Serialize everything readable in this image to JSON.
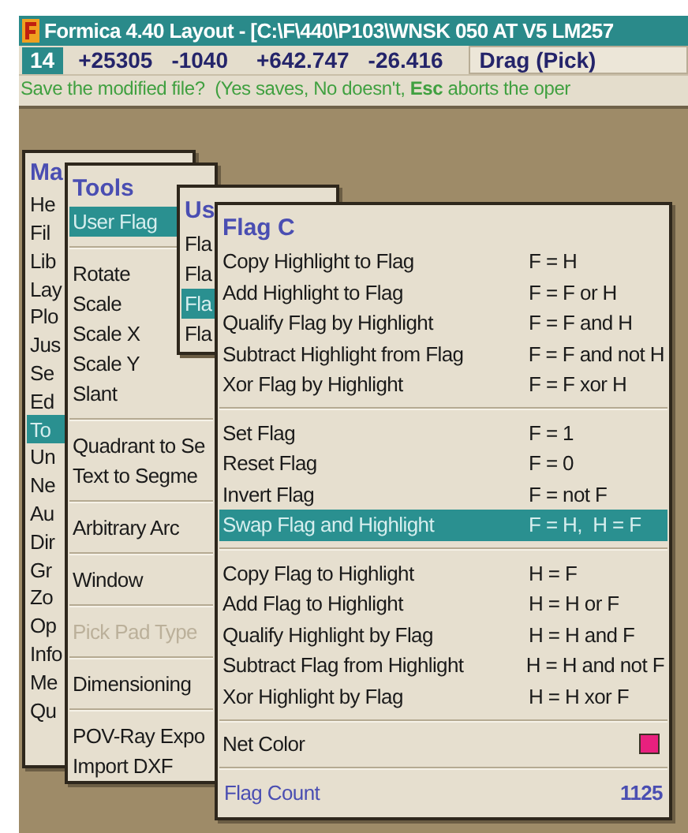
{
  "window": {
    "title": "Formica 4.40 Layout - [C:\\F\\440\\P103\\WNSK 050 AT V5 LM257"
  },
  "toolbar": {
    "layer": "14",
    "values": [
      "+25305",
      "-1040",
      "+642.747",
      "-26.416"
    ],
    "mode": "Drag (Pick)"
  },
  "message": "Save the modified file?  (Yes saves, No doesn't, **Esc** aborts the oper",
  "menus": [
    {
      "title": "Ma",
      "items": [
        {
          "kind": "item",
          "label": "He",
          "selected": false,
          "disabled": false
        },
        {
          "kind": "item",
          "label": "Fil",
          "selected": false,
          "disabled": false
        },
        {
          "kind": "item",
          "label": "Lib",
          "selected": false,
          "disabled": false
        },
        {
          "kind": "item",
          "label": "Lay",
          "selected": false,
          "disabled": false
        },
        {
          "kind": "item",
          "label": "Plo",
          "selected": false,
          "disabled": false
        },
        {
          "kind": "item",
          "label": "Jus",
          "selected": false,
          "disabled": false
        },
        {
          "kind": "item",
          "label": "Se",
          "selected": false,
          "disabled": false
        },
        {
          "kind": "item",
          "label": "Ed",
          "selected": false,
          "disabled": false
        },
        {
          "kind": "item",
          "label": "To",
          "selected": true,
          "disabled": false
        },
        {
          "kind": "item",
          "label": "Un",
          "selected": false,
          "disabled": false
        },
        {
          "kind": "item",
          "label": "Ne",
          "selected": false,
          "disabled": false
        },
        {
          "kind": "item",
          "label": "Au",
          "selected": false,
          "disabled": false
        },
        {
          "kind": "item",
          "label": "Dir",
          "selected": false,
          "disabled": false
        },
        {
          "kind": "item",
          "label": "Gr",
          "selected": false,
          "disabled": false
        },
        {
          "kind": "item",
          "label": "Zo",
          "selected": false,
          "disabled": false
        },
        {
          "kind": "item",
          "label": "Op",
          "selected": false,
          "disabled": false
        },
        {
          "kind": "item",
          "label": "Info",
          "selected": false,
          "disabled": false
        },
        {
          "kind": "item",
          "label": "Me",
          "selected": false,
          "disabled": false
        },
        {
          "kind": "item",
          "label": "Qu",
          "selected": false,
          "disabled": false
        }
      ]
    },
    {
      "title": "Tools",
      "items": [
        {
          "kind": "item",
          "label": "User Flag",
          "selected": true,
          "disabled": false
        },
        {
          "kind": "separator"
        },
        {
          "kind": "item",
          "label": "Rotate",
          "selected": false,
          "disabled": false
        },
        {
          "kind": "item",
          "label": "Scale",
          "selected": false,
          "disabled": false
        },
        {
          "kind": "item",
          "label": "Scale X",
          "selected": false,
          "disabled": false
        },
        {
          "kind": "item",
          "label": "Scale Y",
          "selected": false,
          "disabled": false
        },
        {
          "kind": "item",
          "label": "Slant",
          "selected": false,
          "disabled": false
        },
        {
          "kind": "separator"
        },
        {
          "kind": "item",
          "label": "Quadrant to Se",
          "selected": false,
          "disabled": false
        },
        {
          "kind": "item",
          "label": "Text to Segme",
          "selected": false,
          "disabled": false
        },
        {
          "kind": "separator"
        },
        {
          "kind": "item",
          "label": "Arbitrary Arc",
          "selected": false,
          "disabled": false
        },
        {
          "kind": "separator"
        },
        {
          "kind": "item",
          "label": "Window",
          "selected": false,
          "disabled": false
        },
        {
          "kind": "separator"
        },
        {
          "kind": "item",
          "label": "Pick Pad Type",
          "selected": false,
          "disabled": true
        },
        {
          "kind": "separator"
        },
        {
          "kind": "item",
          "label": "Dimensioning",
          "selected": false,
          "disabled": false
        },
        {
          "kind": "separator"
        },
        {
          "kind": "item",
          "label": "POV-Ray Expo",
          "selected": false,
          "disabled": false
        },
        {
          "kind": "item",
          "label": "Import DXF",
          "selected": false,
          "disabled": false
        }
      ]
    },
    {
      "title": "Us",
      "items": [
        {
          "kind": "item",
          "label": "Fla",
          "selected": false,
          "disabled": false
        },
        {
          "kind": "item",
          "label": "Fla",
          "selected": false,
          "disabled": false
        },
        {
          "kind": "item",
          "label": "Fla",
          "selected": true,
          "disabled": false
        },
        {
          "kind": "item",
          "label": "Fla",
          "selected": false,
          "disabled": false
        }
      ]
    },
    {
      "title": "Flag C",
      "items": [
        {
          "kind": "item",
          "label": "Copy Highlight to Flag",
          "shortcut": "F = H",
          "selected": false,
          "disabled": false
        },
        {
          "kind": "item",
          "label": "Add Highlight to Flag",
          "shortcut": "F = F or H",
          "selected": false,
          "disabled": false
        },
        {
          "kind": "item",
          "label": "Qualify Flag by Highlight",
          "shortcut": "F = F and H",
          "selected": false,
          "disabled": false
        },
        {
          "kind": "item",
          "label": "Subtract Highlight from Flag",
          "shortcut": "F = F and not H",
          "selected": false,
          "disabled": false
        },
        {
          "kind": "item",
          "label": "Xor Flag by Highlight",
          "shortcut": "F = F xor H",
          "selected": false,
          "disabled": false
        },
        {
          "kind": "separator"
        },
        {
          "kind": "item",
          "label": "Set Flag",
          "shortcut": "F = 1",
          "selected": false,
          "disabled": false
        },
        {
          "kind": "item",
          "label": "Reset Flag",
          "shortcut": "F = 0",
          "selected": false,
          "disabled": false
        },
        {
          "kind": "item",
          "label": "Invert Flag",
          "shortcut": "F = not F",
          "selected": false,
          "disabled": false
        },
        {
          "kind": "item",
          "label": "Swap Flag and Highlight",
          "shortcut": "F = H,  H = F",
          "selected": true,
          "disabled": false
        },
        {
          "kind": "separator"
        },
        {
          "kind": "item",
          "label": "Copy Flag to Highlight",
          "shortcut": "H = F",
          "selected": false,
          "disabled": false
        },
        {
          "kind": "item",
          "label": "Add Flag to Highlight",
          "shortcut": "H = H or F",
          "selected": false,
          "disabled": false
        },
        {
          "kind": "item",
          "label": "Qualify Highlight by Flag",
          "shortcut": "H = H and F",
          "selected": false,
          "disabled": false
        },
        {
          "kind": "item",
          "label": "Subtract Flag from Highlight",
          "shortcut": "H = H and not F",
          "selected": false,
          "disabled": false
        },
        {
          "kind": "item",
          "label": "Xor Highlight by Flag",
          "shortcut": "H = H xor F",
          "selected": false,
          "disabled": false
        },
        {
          "kind": "separator"
        },
        {
          "kind": "color",
          "label": "Net Color",
          "color": "#e8207e",
          "selected": false,
          "disabled": false
        },
        {
          "kind": "separator"
        },
        {
          "kind": "count",
          "label": "Flag Count",
          "value": "1125"
        }
      ]
    }
  ]
}
